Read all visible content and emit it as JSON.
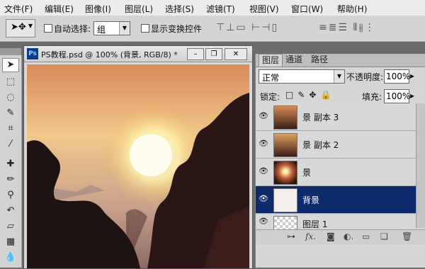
{
  "menu": [
    "文件(F)",
    "编辑(E)",
    "图像(I)",
    "图层(L)",
    "选择(S)",
    "滤镜(T)",
    "视图(V)",
    "窗口(W)",
    "帮助(H)"
  ],
  "options": {
    "auto_select_label": "自动选择:",
    "auto_select_value": "组",
    "show_transform_label": "显示变换控件"
  },
  "document": {
    "title": "PS教程.psd @ 100% (背景, RGB/8) *",
    "app_badge": "Ps",
    "minimize": "–",
    "restore": "❐",
    "close": "✕"
  },
  "layers_panel": {
    "tabs": [
      "图层",
      "通道",
      "路径"
    ],
    "blend_mode": "正常",
    "opacity_label": "不透明度:",
    "opacity_value": "100%",
    "lock_label": "锁定:",
    "fill_label": "填充:",
    "fill_value": "100%",
    "layers": [
      {
        "name": "景 副本 3"
      },
      {
        "name": "景 副本 2"
      },
      {
        "name": "景"
      },
      {
        "name": "背景",
        "selected": true
      },
      {
        "name": "图层 1"
      }
    ]
  },
  "colors": {
    "selection": "#0d2a6b",
    "panel": "#d6d6d6"
  }
}
